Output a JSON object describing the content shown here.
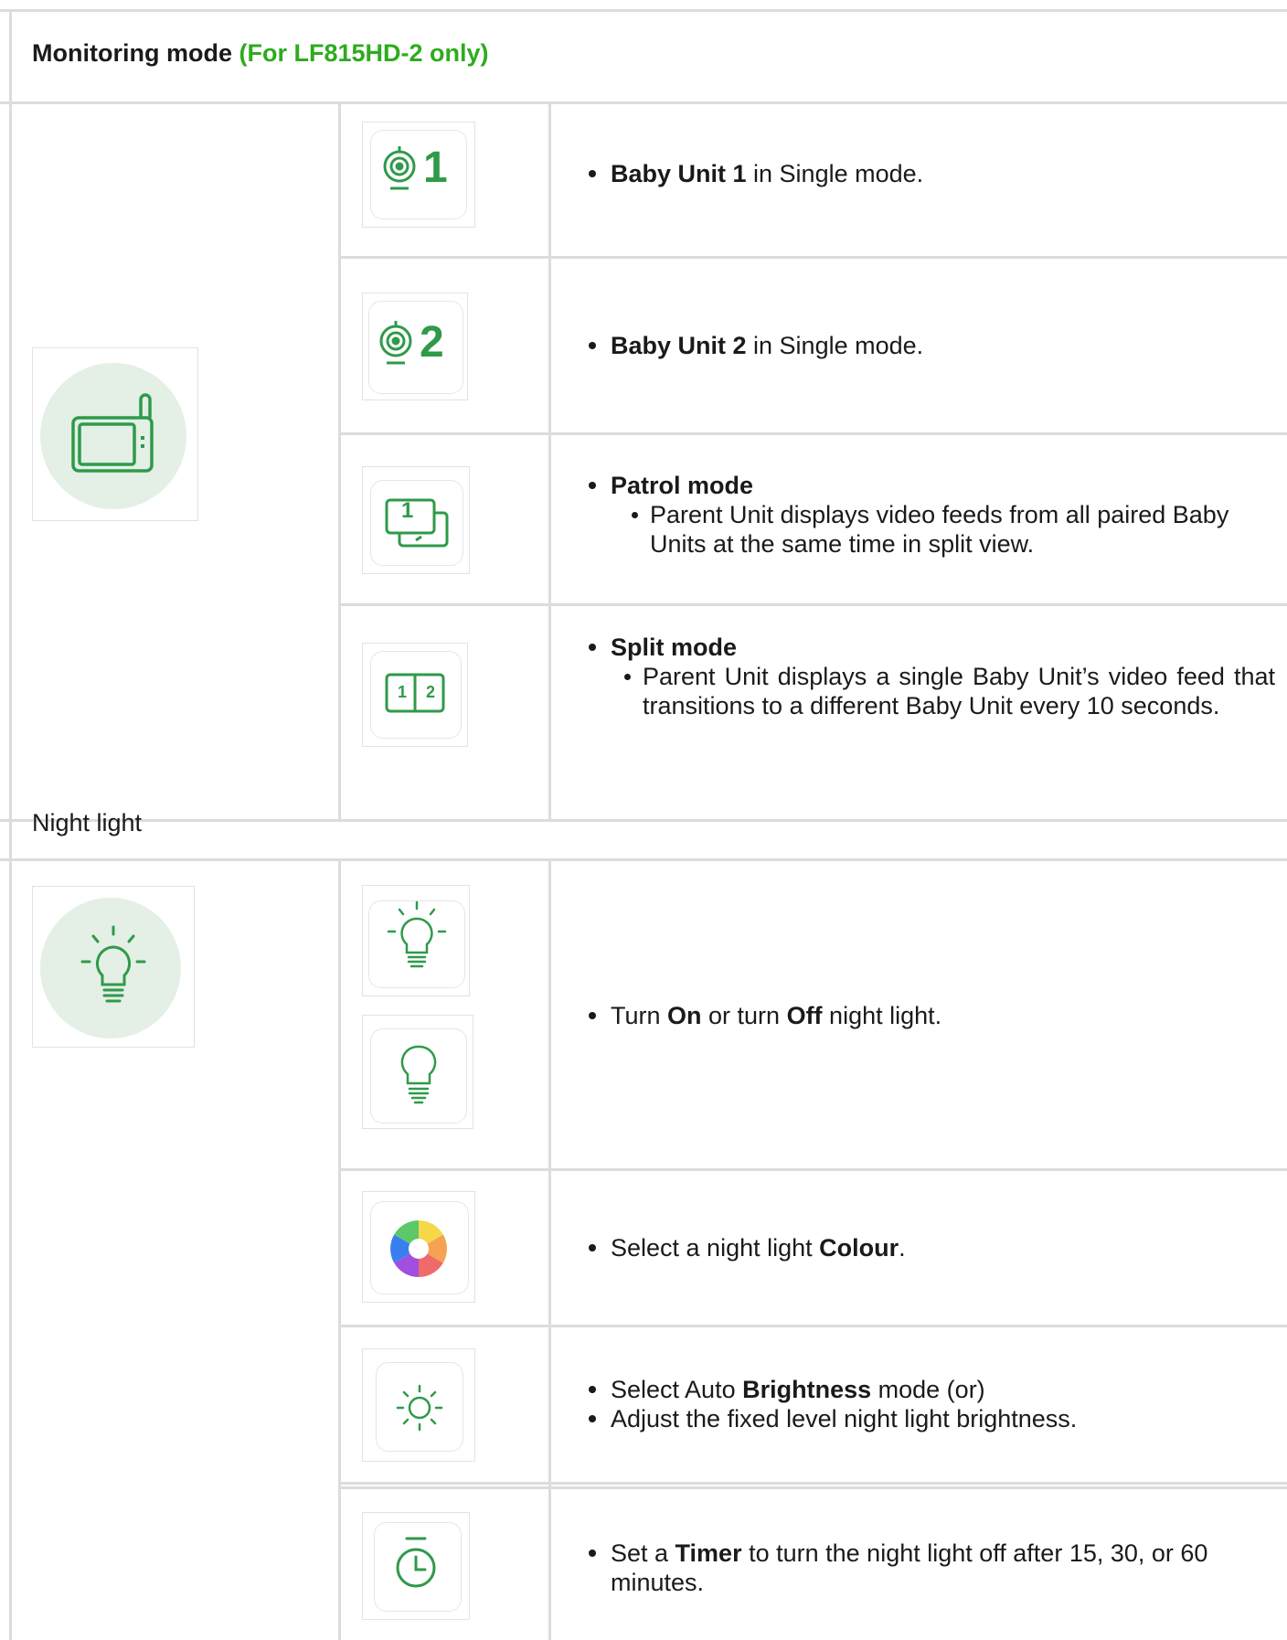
{
  "monitoring": {
    "title": "Monitoring mode",
    "note": "(For LF815HD-2 only)",
    "rows": [
      {
        "icon": "baby-unit-1-icon",
        "bold": "Baby Unit 1",
        "rest": " in Single mode."
      },
      {
        "icon": "baby-unit-2-icon",
        "bold": "Baby Unit 2",
        "rest": " in Single mode."
      },
      {
        "icon": "patrol-mode-icon",
        "bold": "Patrol mode",
        "sub": "Parent Unit displays video feeds from all paired Baby Units at the same time in split view."
      },
      {
        "icon": "split-mode-icon",
        "bold": "Split mode",
        "sub": "Parent Unit displays a single Baby Unit’s video feed that transitions to a different Baby Unit every 10 seconds."
      }
    ],
    "patrol_icon_label": "1",
    "split_icon_labels": [
      "1",
      "2"
    ],
    "unit1_icon_label": "1",
    "unit2_icon_label": "2"
  },
  "night_light": {
    "title": "Night light",
    "rows": [
      {
        "pre": "Turn ",
        "b1": "On",
        "mid": " or turn ",
        "b2": "Off",
        "post": " night light."
      },
      {
        "pre": "Select a night light ",
        "b1": "Colour",
        "post": "."
      },
      {
        "line1_pre": "Select Auto ",
        "line1_b": "Brightness",
        "line1_post": " mode (or)",
        "line2": "Adjust the fixed level night light brightness."
      },
      {
        "pre": "Set a ",
        "b1": "Timer",
        "post": " to turn the night light off after 15, 30, or 60 minutes."
      }
    ]
  },
  "colors": {
    "accent": "#2eab1e",
    "icon_green": "#2f9a4a",
    "circle_bg": "#e4efe6",
    "grid": "#dcdcdc"
  }
}
